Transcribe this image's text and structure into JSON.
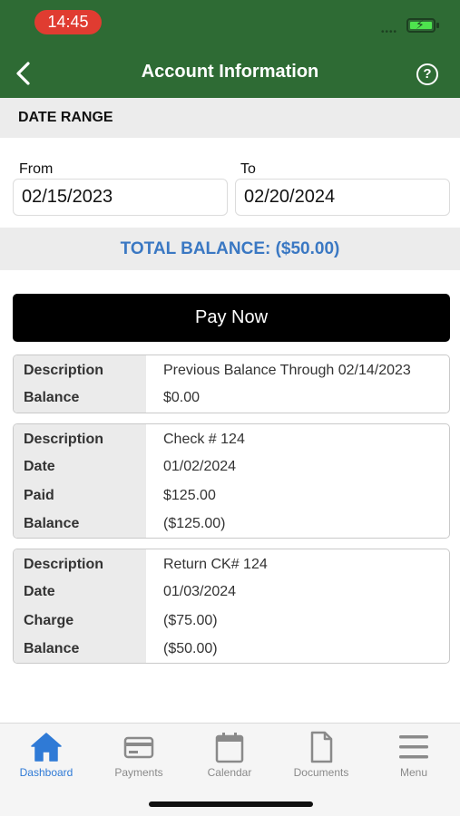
{
  "status_bar": {
    "time": "14:45"
  },
  "header": {
    "title": "Account Information",
    "help_glyph": "?"
  },
  "date_range": {
    "heading": "DATE RANGE",
    "from_label": "From",
    "from_value": "02/15/2023",
    "to_label": "To",
    "to_value": "02/20/2024"
  },
  "total_balance": "TOTAL BALANCE: ($50.00)",
  "pay_now_label": "Pay Now",
  "transactions": [
    {
      "rows": [
        {
          "label": "Description",
          "value": "Previous Balance Through 02/14/2023"
        },
        {
          "label": "Balance",
          "value": "$0.00"
        }
      ]
    },
    {
      "rows": [
        {
          "label": "Description",
          "value": "Check # 124"
        },
        {
          "label": "Date",
          "value": "01/02/2024"
        },
        {
          "label": "Paid",
          "value": "$125.00"
        },
        {
          "label": "Balance",
          "value": "($125.00)"
        }
      ]
    },
    {
      "rows": [
        {
          "label": "Description",
          "value": "Return CK# 124"
        },
        {
          "label": "Date",
          "value": "01/03/2024"
        },
        {
          "label": "Charge",
          "value": "($75.00)"
        },
        {
          "label": "Balance",
          "value": "($50.00)"
        }
      ]
    }
  ],
  "tab_bar": {
    "active": "Dashboard",
    "tabs": [
      {
        "label": "Dashboard",
        "icon": "home-icon"
      },
      {
        "label": "Payments",
        "icon": "credit-card-icon"
      },
      {
        "label": "Calendar",
        "icon": "calendar-icon"
      },
      {
        "label": "Documents",
        "icon": "document-icon"
      },
      {
        "label": "Menu",
        "icon": "menu-icon"
      }
    ]
  },
  "colors": {
    "header_green": "#2e6b34",
    "accent_blue": "#3a78c3",
    "active_tab_blue": "#2f7ad6",
    "time_pill_red": "#e03c31"
  }
}
